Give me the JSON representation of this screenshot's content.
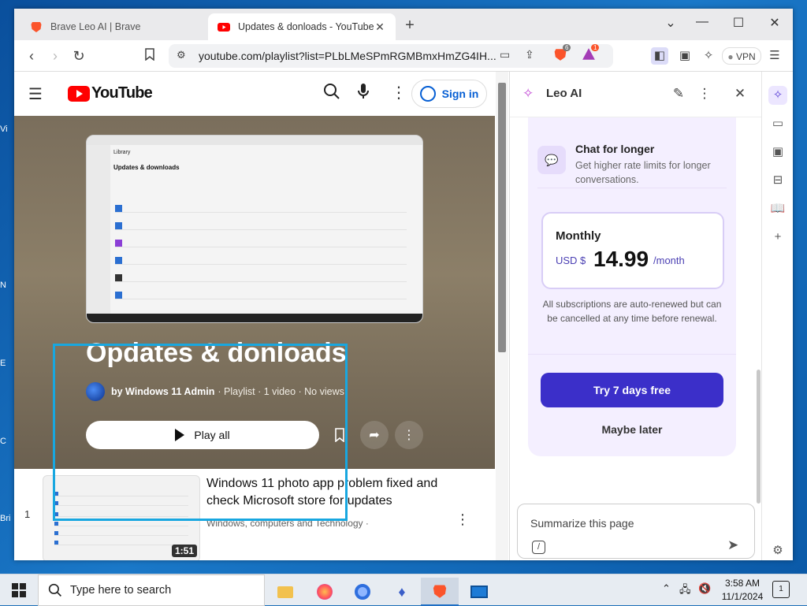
{
  "desktop": {
    "left_icons": [
      "Vi",
      "N",
      "E",
      "C",
      "Bri"
    ]
  },
  "browser": {
    "tabs": [
      {
        "title": "Brave Leo AI | Brave",
        "active": false
      },
      {
        "title": "Updates & donloads - YouTube",
        "active": true
      }
    ],
    "address": "youtube.com/playlist?list=PLbLMeSPmRGMBmxHmZG4IH...",
    "brave_badge": "6",
    "rewards_badge": "1",
    "vpn_label": "VPN"
  },
  "youtube": {
    "logo_text": "YouTube",
    "signin_label": "Sign in",
    "thumb_heading": "Updates & downloads",
    "thumb_library": "Library",
    "playlist_title": "Opdates & donloads",
    "owner": "by Windows 11 Admin",
    "meta": "· Playlist · 1 video · No views",
    "play_all": "Play all",
    "videos": [
      {
        "index": "1",
        "title": "Windows 11 photo app problem fixed and check Microsoft store for updates",
        "channel": "Windows, computers and Technology ·",
        "duration": "1:51"
      }
    ]
  },
  "leo": {
    "title": "Leo AI",
    "feature_title": "Chat for longer",
    "feature_desc": "Get higher rate limits for longer conversations.",
    "plan_name": "Monthly",
    "currency": "USD $",
    "price": "14.99",
    "period": "/month",
    "terms": "All subscriptions are auto-renewed but can be cancelled at any time before renewal.",
    "try_label": "Try 7 days free",
    "maybe_label": "Maybe later",
    "input_placeholder": "Summarize this page"
  },
  "taskbar": {
    "search_placeholder": "Type here to search",
    "time": "3:58 AM",
    "date": "11/1/2024",
    "notif_count": "1"
  },
  "colors": {
    "brave_orange": "#fb542b",
    "yt_red": "#ff0000",
    "leo_purple": "#3b2fc9",
    "highlight": "#18a7e0"
  }
}
